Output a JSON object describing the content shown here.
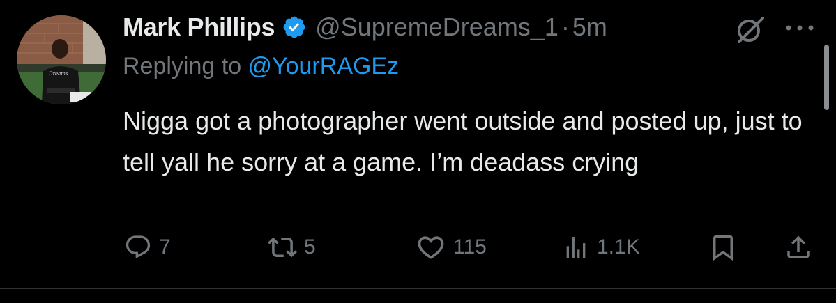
{
  "colors": {
    "background": "#000000",
    "text_primary": "#e7e9ea",
    "text_secondary": "#71767b",
    "link": "#1d9bf0",
    "verified": "#1d9bf0"
  },
  "tweet": {
    "author": {
      "display_name": "Mark Phillips",
      "handle": "@SupremeDreams_1",
      "verified": true
    },
    "separator": "·",
    "timestamp": "5m",
    "reply_prefix": "Replying to ",
    "reply_to": "@YourRAGEz",
    "text": "Nigga got a photographer went outside and posted up, just to tell yall he sorry at a game. I’m deadass crying",
    "icons": {
      "top_right": [
        "grok-icon",
        "more-icon"
      ]
    },
    "actions": {
      "replies": "7",
      "reposts": "5",
      "likes": "115",
      "views": "1.1K"
    }
  }
}
